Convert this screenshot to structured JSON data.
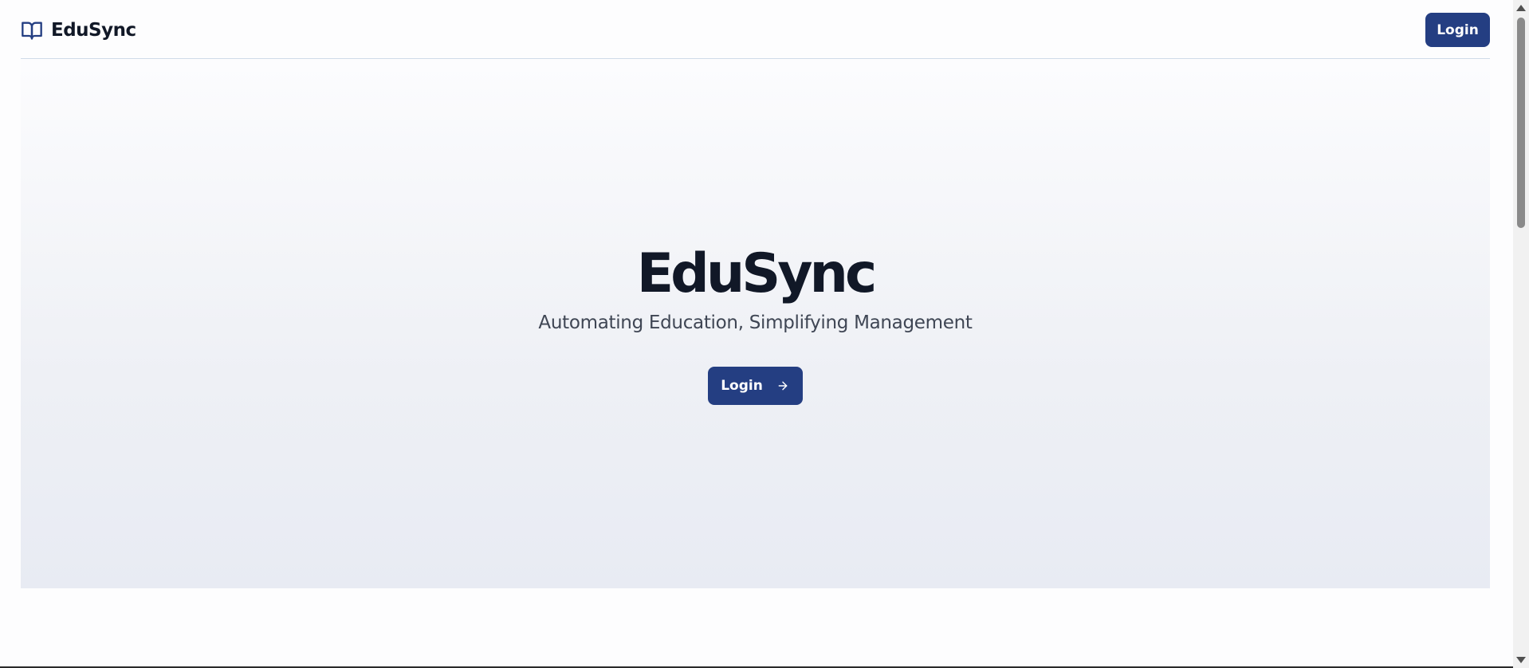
{
  "header": {
    "brand_name": "EduSync",
    "brand_icon": "book-open-icon",
    "login_label": "Login"
  },
  "hero": {
    "title": "EduSync",
    "subtitle": "Automating Education, Simplifying Management",
    "login_label": "Login",
    "login_icon": "arrow-right-icon"
  },
  "colors": {
    "primary": "#243e82",
    "title_text": "#111827",
    "subtitle_text": "#3f4654",
    "header_border": "#cfdbe8"
  }
}
